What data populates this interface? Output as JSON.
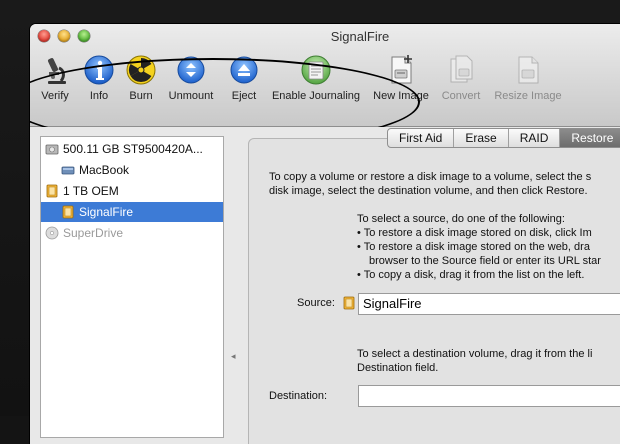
{
  "window": {
    "title": "SignalFire"
  },
  "toolbar": {
    "items": [
      {
        "label": "Verify",
        "icon": "microscope-icon",
        "enabled": true
      },
      {
        "label": "Info",
        "icon": "info-icon",
        "enabled": true
      },
      {
        "label": "Burn",
        "icon": "burn-icon",
        "enabled": true
      },
      {
        "label": "Unmount",
        "icon": "unmount-icon",
        "enabled": true
      },
      {
        "label": "Eject",
        "icon": "eject-icon",
        "enabled": true
      },
      {
        "label": "Enable Journaling",
        "icon": "journaling-icon",
        "enabled": true
      },
      {
        "label": "New Image",
        "icon": "new-image-icon",
        "enabled": true
      },
      {
        "label": "Convert",
        "icon": "convert-icon",
        "enabled": false
      },
      {
        "label": "Resize Image",
        "icon": "resize-image-icon",
        "enabled": false
      }
    ]
  },
  "sidebar": {
    "items": [
      {
        "label": "500.11 GB ST9500420A...",
        "icon": "hard-disk-icon",
        "selected": false,
        "dim": false
      },
      {
        "label": "MacBook",
        "icon": "volume-icon",
        "selected": false,
        "dim": false
      },
      {
        "label": "1 TB OEM",
        "icon": "external-disk-icon",
        "selected": false,
        "dim": false
      },
      {
        "label": "SignalFire",
        "icon": "external-volume-icon",
        "selected": true,
        "dim": false
      },
      {
        "label": "SuperDrive",
        "icon": "optical-drive-icon",
        "selected": false,
        "dim": true
      }
    ]
  },
  "tabs": {
    "items": [
      {
        "label": "First Aid",
        "active": false
      },
      {
        "label": "Erase",
        "active": false
      },
      {
        "label": "RAID",
        "active": false
      },
      {
        "label": "Restore",
        "active": true
      }
    ]
  },
  "restore": {
    "intro_line1": "To copy a volume or restore a disk image to a volume, select the s",
    "intro_line2": "disk image, select the destination volume, and then click Restore.",
    "source_heading": "To select a source, do one of the following:",
    "bullet1": "• To restore a disk image stored on disk, click Im",
    "bullet2a": "• To restore a disk image stored on the web, dra",
    "bullet2b": "browser to the Source field or enter its URL star",
    "bullet3": "• To copy a disk, drag it from the list on the left.",
    "source_label": "Source:",
    "source_value": "SignalFire",
    "dest_help1": "To select a destination volume, drag it from the li",
    "dest_help2": "Destination field.",
    "destination_label": "Destination:",
    "destination_value": ""
  },
  "colors": {
    "selection": "#3d7bd6",
    "annotation_ring": "#000000"
  }
}
